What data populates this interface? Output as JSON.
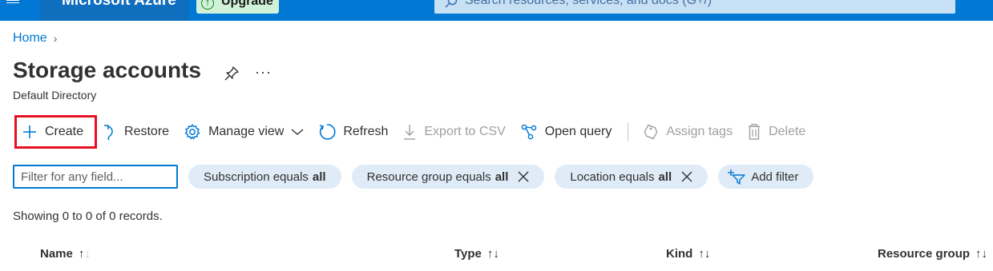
{
  "topbar": {
    "brand": "Microsoft Azure",
    "upgrade_label": "Upgrade",
    "search_placeholder": "Search resources, services, and docs (G+/)"
  },
  "breadcrumb": {
    "home": "Home"
  },
  "page": {
    "title": "Storage accounts",
    "subtitle": "Default Directory"
  },
  "toolbar": {
    "create": "Create",
    "restore": "Restore",
    "manage_view": "Manage view",
    "refresh": "Refresh",
    "export_csv": "Export to CSV",
    "open_query": "Open query",
    "assign_tags": "Assign tags",
    "delete": "Delete"
  },
  "filters": {
    "placeholder": "Filter for any field...",
    "subscription_prefix": "Subscription equals",
    "subscription_value": "all",
    "resource_group_prefix": "Resource group equals",
    "resource_group_value": "all",
    "location_prefix": "Location equals",
    "location_value": "all",
    "add_filter": "Add filter"
  },
  "records_text": "Showing 0 to 0 of 0 records.",
  "table": {
    "columns": [
      "Name",
      "Type",
      "Kind",
      "Resource group"
    ]
  },
  "colors": {
    "azure_blue": "#0078d4",
    "highlight_red": "#e81123",
    "pill_bg": "#dfecf8"
  }
}
